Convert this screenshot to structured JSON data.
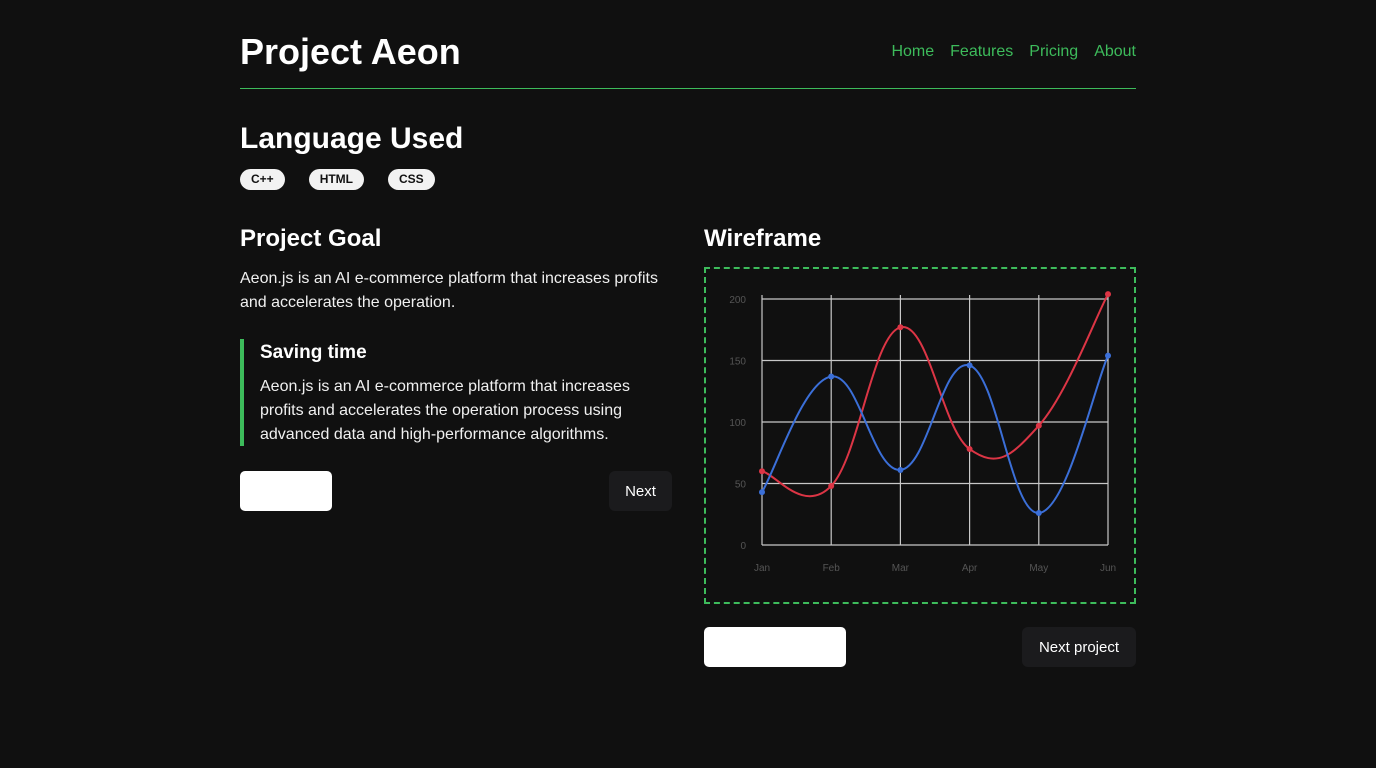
{
  "header": {
    "title": "Project Aeon",
    "nav": [
      "Home",
      "Features",
      "Pricing",
      "About"
    ]
  },
  "languages": {
    "title": "Language Used",
    "tags": [
      "C++",
      "HTML",
      "CSS"
    ]
  },
  "goal": {
    "title": "Project Goal",
    "text": "Aeon.js is an AI e-commerce platform that increases profits and accelerates the operation.",
    "quote_title": "Saving time",
    "quote_text": "Aeon.js is an AI e-commerce platform that increases profits and accelerates the operation process using advanced data and high-performance algorithms.",
    "prev_label": "",
    "next_label": "Next"
  },
  "wireframe": {
    "title": "Wireframe",
    "prev_label": "",
    "next_label": "Next project"
  },
  "colors": {
    "accent": "#3dbb5b",
    "series_red": "#dc3545",
    "series_blue": "#3b6fd8",
    "grid": "#c8c8c8"
  },
  "chart_data": {
    "type": "line",
    "categories": [
      "Jan",
      "Feb",
      "Mar",
      "Apr",
      "May",
      "Jun"
    ],
    "ylim": [
      0,
      200
    ],
    "yticks": [
      0,
      50,
      100,
      150,
      200
    ],
    "grid": true,
    "series": [
      {
        "color": "#dc3545",
        "values": [
          60,
          48,
          177,
          78,
          97,
          204
        ]
      },
      {
        "color": "#3b6fd8",
        "values": [
          43,
          137,
          61,
          146,
          26,
          154
        ]
      }
    ]
  }
}
